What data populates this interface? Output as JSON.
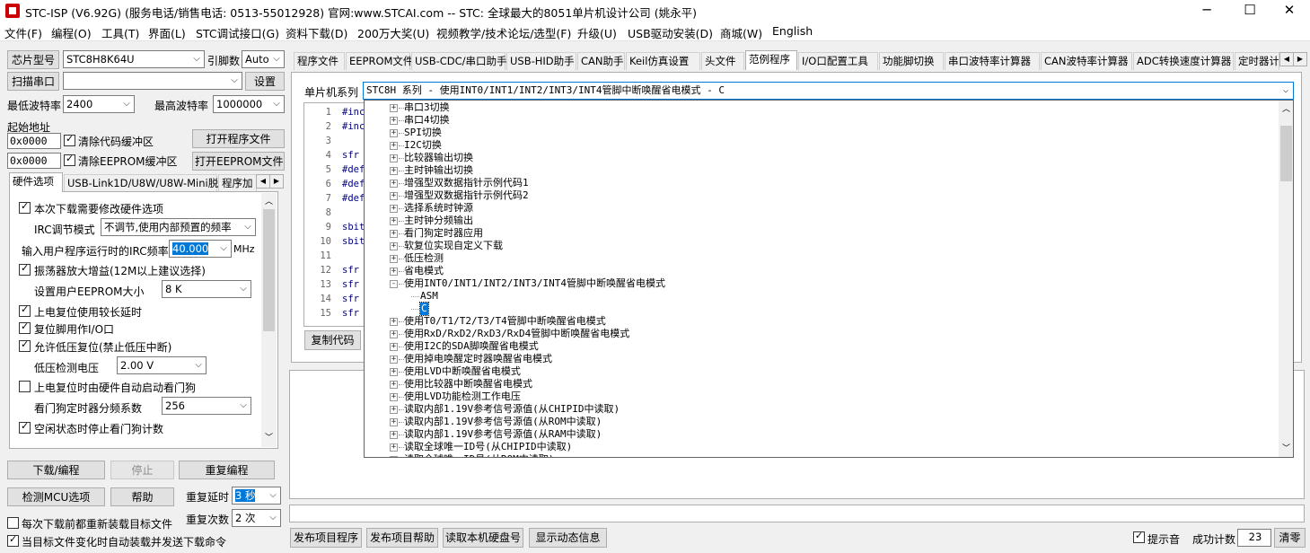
{
  "window": {
    "title": "STC-ISP (V6.92G) (服务电话/销售电话: 0513-55012928) 官网:www.STCAI.com  -- STC: 全球最大的8051单片机设计公司 (姚永平)",
    "minimize": "─",
    "maximize": "☐",
    "close": "✕"
  },
  "menu": [
    "文件(F)",
    "编程(O)",
    "工具(T)",
    "界面(L)",
    "STC调试接口(G)",
    "资料下载(D)",
    "200万大奖(U)",
    "视频教学/技术论坛/选型(F)",
    "升级(U)",
    "USB驱动安装(D)",
    "商城(W)",
    "English"
  ],
  "left": {
    "chip_model_label": "芯片型号",
    "chip_model_value": "STC8H8K64U",
    "pin_count_label": "引脚数",
    "pin_count_value": "Auto",
    "scan_port_label": "扫描串口",
    "port_value": "",
    "settings_label": "设置",
    "min_baud_label": "最低波特率",
    "min_baud_value": "2400",
    "max_baud_label": "最高波特率",
    "max_baud_value": "1000000",
    "start_addr_label": "起始地址",
    "addr1_value": "0x0000",
    "clear_code_label": "清除代码缓冲区",
    "open_program_label": "打开程序文件",
    "addr2_value": "0x0000",
    "clear_eeprom_label": "清除EEPROM缓冲区",
    "open_eeprom_label": "打开EEPROM文件",
    "tabs": [
      "硬件选项",
      "USB-Link1D/U8W/U8W-Mini脱机",
      "程序加"
    ],
    "hw": {
      "modify_hw_label": "本次下载需要修改硬件选项",
      "irc_mode_label": "IRC调节模式",
      "irc_mode_value": "不调节,使用内部预置的频率",
      "irc_freq_label": "输入用户程序运行时的IRC频率",
      "irc_freq_value": "40.000",
      "irc_freq_unit": "MHz",
      "osc_gain_label": "振荡器放大增益(12M以上建议选择)",
      "eeprom_size_label": "设置用户EEPROM大小",
      "eeprom_size_value": "8   K",
      "long_delay_label": "上电复位使用较长延时",
      "reset_io_label": "复位脚用作I/O口",
      "low_volt_reset_label": "允许低压复位(禁止低压中断)",
      "low_volt_label": "低压检测电压",
      "low_volt_value": "2.00 V",
      "watchdog_auto_label": "上电复位时由硬件自动启动看门狗",
      "watchdog_div_label": "看门狗定时器分频系数",
      "watchdog_div_value": "256",
      "idle_stop_wdt_label": "空闲状态时停止看门狗计数"
    },
    "download_label": "下载/编程",
    "stop_label": "停止",
    "reprogram_label": "重复编程",
    "detect_mcu_label": "检测MCU选项",
    "help_label": "帮助",
    "repeat_delay_label": "重复延时",
    "repeat_delay_value": "3 秒",
    "repeat_count_label": "重复次数",
    "repeat_count_value": "2 次",
    "reload_each_label": "每次下载前都重新装载目标文件",
    "auto_load_label": "当目标文件变化时自动装载并发送下载命令"
  },
  "right": {
    "tabs": [
      "程序文件",
      "EEPROM文件",
      "USB-CDC/串口助手",
      "USB-HID助手",
      "CAN助手",
      "Keil仿真设置",
      "头文件",
      "范例程序",
      "I/O口配置工具",
      "功能脚切换",
      "串口波特率计算器",
      "CAN波特率计算器",
      "ADC转换速度计算器",
      "定时器计"
    ],
    "mcu_series_label": "单片机系列",
    "mcu_series_value": "STC8H 系列 - 使用INT0/INT1/INT2/INT3/INT4管脚中断唤醒省电模式 - C",
    "copy_code_label": "复制代码",
    "code_lines": [
      {
        "n": "1",
        "t": "#inc"
      },
      {
        "n": "2",
        "t": "#inc"
      },
      {
        "n": "3",
        "t": ""
      },
      {
        "n": "4",
        "t": "sfr"
      },
      {
        "n": "5",
        "t": "#def"
      },
      {
        "n": "6",
        "t": "#def"
      },
      {
        "n": "7",
        "t": "#def"
      },
      {
        "n": "8",
        "t": ""
      },
      {
        "n": "9",
        "t": "sbit"
      },
      {
        "n": "10",
        "t": "sbit"
      },
      {
        "n": "11",
        "t": ""
      },
      {
        "n": "12",
        "t": "sfr"
      },
      {
        "n": "13",
        "t": "sfr"
      },
      {
        "n": "14",
        "t": "sfr"
      },
      {
        "n": "15",
        "t": "sfr"
      }
    ],
    "tree": [
      {
        "t": "串口3切换",
        "lv": 0,
        "box": "+"
      },
      {
        "t": "串口4切换",
        "lv": 0,
        "box": "+"
      },
      {
        "t": "SPI切换",
        "lv": 0,
        "box": "+"
      },
      {
        "t": "I2C切换",
        "lv": 0,
        "box": "+"
      },
      {
        "t": "比较器输出切换",
        "lv": 0,
        "box": "+"
      },
      {
        "t": "主时钟输出切换",
        "lv": 0,
        "box": "+"
      },
      {
        "t": "增强型双数据指针示例代码1",
        "lv": 0,
        "box": "+"
      },
      {
        "t": "增强型双数据指针示例代码2",
        "lv": 0,
        "box": "+"
      },
      {
        "t": "选择系统时钟源",
        "lv": 0,
        "box": "+"
      },
      {
        "t": "主时钟分频输出",
        "lv": 0,
        "box": "+"
      },
      {
        "t": "看门狗定时器应用",
        "lv": 0,
        "box": "+"
      },
      {
        "t": "软复位实现自定义下载",
        "lv": 0,
        "box": "+"
      },
      {
        "t": "低压检测",
        "lv": 0,
        "box": "+"
      },
      {
        "t": "省电模式",
        "lv": 0,
        "box": "+"
      },
      {
        "t": "使用INT0/INT1/INT2/INT3/INT4管脚中断唤醒省电模式",
        "lv": 0,
        "box": "-"
      },
      {
        "t": "ASM",
        "lv": 1,
        "box": ""
      },
      {
        "t": "C",
        "lv": 1,
        "box": "",
        "sel": true
      },
      {
        "t": "使用T0/T1/T2/T3/T4管脚中断唤醒省电模式",
        "lv": 0,
        "box": "+"
      },
      {
        "t": "使用RxD/RxD2/RxD3/RxD4管脚中断唤醒省电模式",
        "lv": 0,
        "box": "+"
      },
      {
        "t": "使用I2C的SDA脚唤醒省电模式",
        "lv": 0,
        "box": "+"
      },
      {
        "t": "使用掉电唤醒定时器唤醒省电模式",
        "lv": 0,
        "box": "+"
      },
      {
        "t": "使用LVD中断唤醒省电模式",
        "lv": 0,
        "box": "+"
      },
      {
        "t": "使用比较器中断唤醒省电模式",
        "lv": 0,
        "box": "+"
      },
      {
        "t": "使用LVD功能检测工作电压",
        "lv": 0,
        "box": "+"
      },
      {
        "t": "读取内部1.19V参考信号源值(从CHIPID中读取)",
        "lv": 0,
        "box": "+"
      },
      {
        "t": "读取内部1.19V参考信号源值(从ROM中读取)",
        "lv": 0,
        "box": "+"
      },
      {
        "t": "读取内部1.19V参考信号源值(从RAM中读取)",
        "lv": 0,
        "box": "+"
      },
      {
        "t": "读取全球唯一ID号(从CHIPID中读取)",
        "lv": 0,
        "box": "+"
      },
      {
        "t": "读取全球唯一ID号(从ROM中读取)",
        "lv": 0,
        "box": "+"
      }
    ],
    "publish_program_label": "发布项目程序",
    "publish_help_label": "发布项目帮助",
    "read_disk_label": "读取本机硬盘号",
    "show_dynamic_label": "显示动态信息",
    "beep_label": "提示音",
    "success_count_label": "成功计数",
    "success_count_value": "23",
    "clear_label": "清零"
  }
}
